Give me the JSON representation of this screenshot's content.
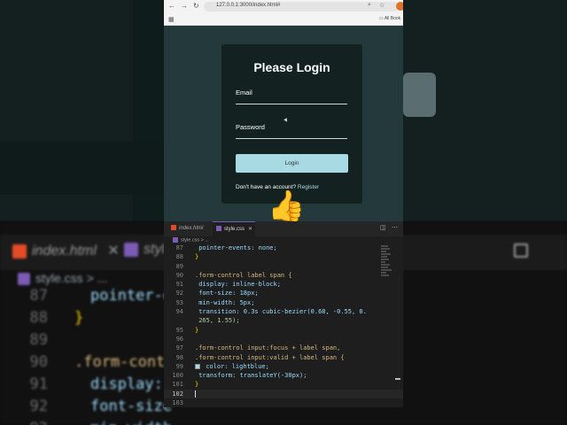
{
  "background": {
    "tabs": [
      {
        "label": "index.html",
        "close": "✕"
      },
      {
        "label": "styl"
      }
    ],
    "crumb": "style.css > ...",
    "lines": [
      {
        "num": "87",
        "code": "pointer-e"
      },
      {
        "num": "88",
        "code": "}"
      },
      {
        "num": "89",
        "code": ""
      },
      {
        "num": "90",
        "code": ".form-contr"
      },
      {
        "num": "91",
        "code": "display:"
      },
      {
        "num": "92",
        "code": "font-size"
      },
      {
        "num": "93",
        "code": "min-width"
      }
    ]
  },
  "browser": {
    "url": "127.0.0.1:3000/index.html#",
    "bookmarks_label": "All Book",
    "nav": {
      "back": "←",
      "forward": "→",
      "reload": "↻"
    }
  },
  "login": {
    "title": "Please Login",
    "email_label": "Email",
    "password_label": "Password",
    "button_label": "Login",
    "register_prompt": "Don't have an account?",
    "register_link": "Register"
  },
  "reaction_emoji": "👍",
  "editor": {
    "tabs": [
      {
        "label": "index.html"
      },
      {
        "label": "style.css",
        "close": "✕"
      }
    ],
    "breadcrumb": "style.css > ...",
    "lines": [
      {
        "num": "87",
        "text": "    pointer-events: none;"
      },
      {
        "num": "88",
        "text": "}"
      },
      {
        "num": "89",
        "text": ""
      },
      {
        "num": "90",
        "text": ".form-control label span {"
      },
      {
        "num": "91",
        "text": "    display: inline-block;"
      },
      {
        "num": "92",
        "text": "    font-size: 18px;"
      },
      {
        "num": "93",
        "text": "    min-width: 5px;"
      },
      {
        "num": "94",
        "text": "    transition: 0.3s cubic-bezier(0.68, -0.55, 0."
      },
      {
        "num": "",
        "text": "    265, 1.55);"
      },
      {
        "num": "95",
        "text": "}"
      },
      {
        "num": "96",
        "text": ""
      },
      {
        "num": "97",
        "text": ".form-control input:focus + label span,"
      },
      {
        "num": "98",
        "text": ".form-control input:valid + label span {"
      },
      {
        "num": "99",
        "text": "    color:  lightblue;"
      },
      {
        "num": "100",
        "text": "    transform: translateY(-30px);"
      },
      {
        "num": "101",
        "text": "}"
      },
      {
        "num": "102",
        "text": ""
      },
      {
        "num": "103",
        "text": ""
      }
    ]
  },
  "colors": {
    "page_bg": "#23393b",
    "card_bg": "#132220",
    "button_bg": "#a8dae3",
    "link": "#a8dae3",
    "editor_bg": "#1e1e1e",
    "css_icon": "#7b5bb5",
    "html_icon": "#e34c26"
  }
}
